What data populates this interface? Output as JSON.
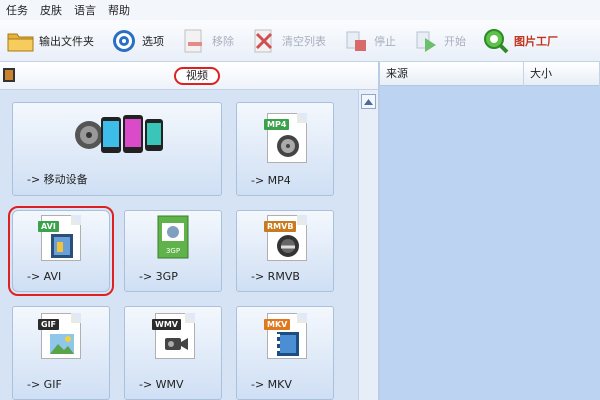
{
  "menu": {
    "items": [
      "任务",
      "皮肤",
      "语言",
      "帮助"
    ]
  },
  "toolbar": {
    "output_folder": "输出文件夹",
    "options": "选项",
    "remove": "移除",
    "clear_list": "清空列表",
    "stop": "停止",
    "start": "开始",
    "picture_factory": "图片工厂"
  },
  "left_panel": {
    "category_title": "视频",
    "tiles": [
      {
        "label": "-> 移动设备",
        "icon": "mobile-devices-icon"
      },
      {
        "label": "-> MP4",
        "icon": "mp4-file-icon",
        "tag": "MP4"
      },
      {
        "label": "-> AVI",
        "icon": "avi-file-icon",
        "tag": "AVI",
        "selected": true
      },
      {
        "label": "-> 3GP",
        "icon": "3gp-file-icon",
        "tag": "3GP"
      },
      {
        "label": "-> RMVB",
        "icon": "rmvb-file-icon",
        "tag": "RMVB"
      },
      {
        "label": "-> GIF",
        "icon": "gif-file-icon",
        "tag": "GIF"
      },
      {
        "label": "-> WMV",
        "icon": "wmv-file-icon",
        "tag": "WMV"
      },
      {
        "label": "-> MKV",
        "icon": "mkv-file-icon",
        "tag": "MKV"
      }
    ]
  },
  "right_panel": {
    "columns": [
      "来源",
      "大小"
    ]
  },
  "colors": {
    "highlight": "#e02020",
    "accent_text": "#c2331c",
    "panel_bg": "#bcd3f1"
  }
}
